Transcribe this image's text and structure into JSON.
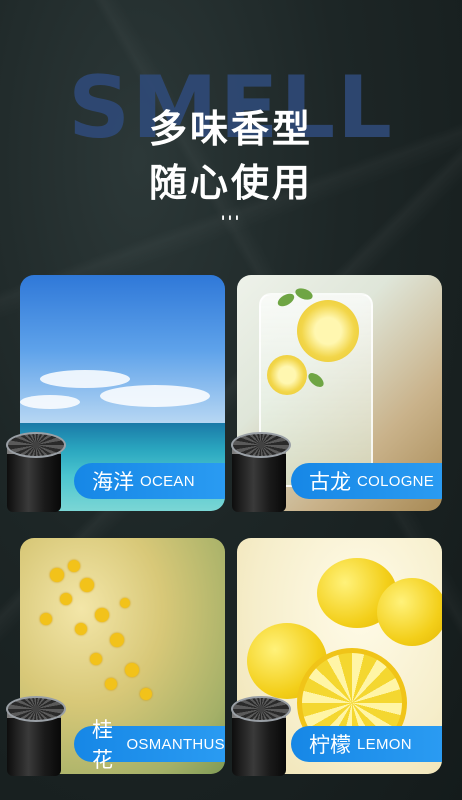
{
  "background_word": "SMELL",
  "headline": {
    "line1": "多味香型",
    "line2": "随心使用"
  },
  "decor_dots": "'''",
  "cards": [
    {
      "cn": "海洋",
      "en": "OCEAN",
      "image": "ocean-sky-sea"
    },
    {
      "cn": "古龙",
      "en": "COLOGNE",
      "image": "lemon-mint-drink"
    },
    {
      "cn": "桂花",
      "en": "OSMANTHUS",
      "image": "osmanthus-flowers"
    },
    {
      "cn": "柠檬",
      "en": "LEMON",
      "image": "lemons"
    }
  ],
  "colors": {
    "label_blue": "#1a8cea",
    "background": "#1d2626",
    "bg_word": "#2f4a78"
  }
}
